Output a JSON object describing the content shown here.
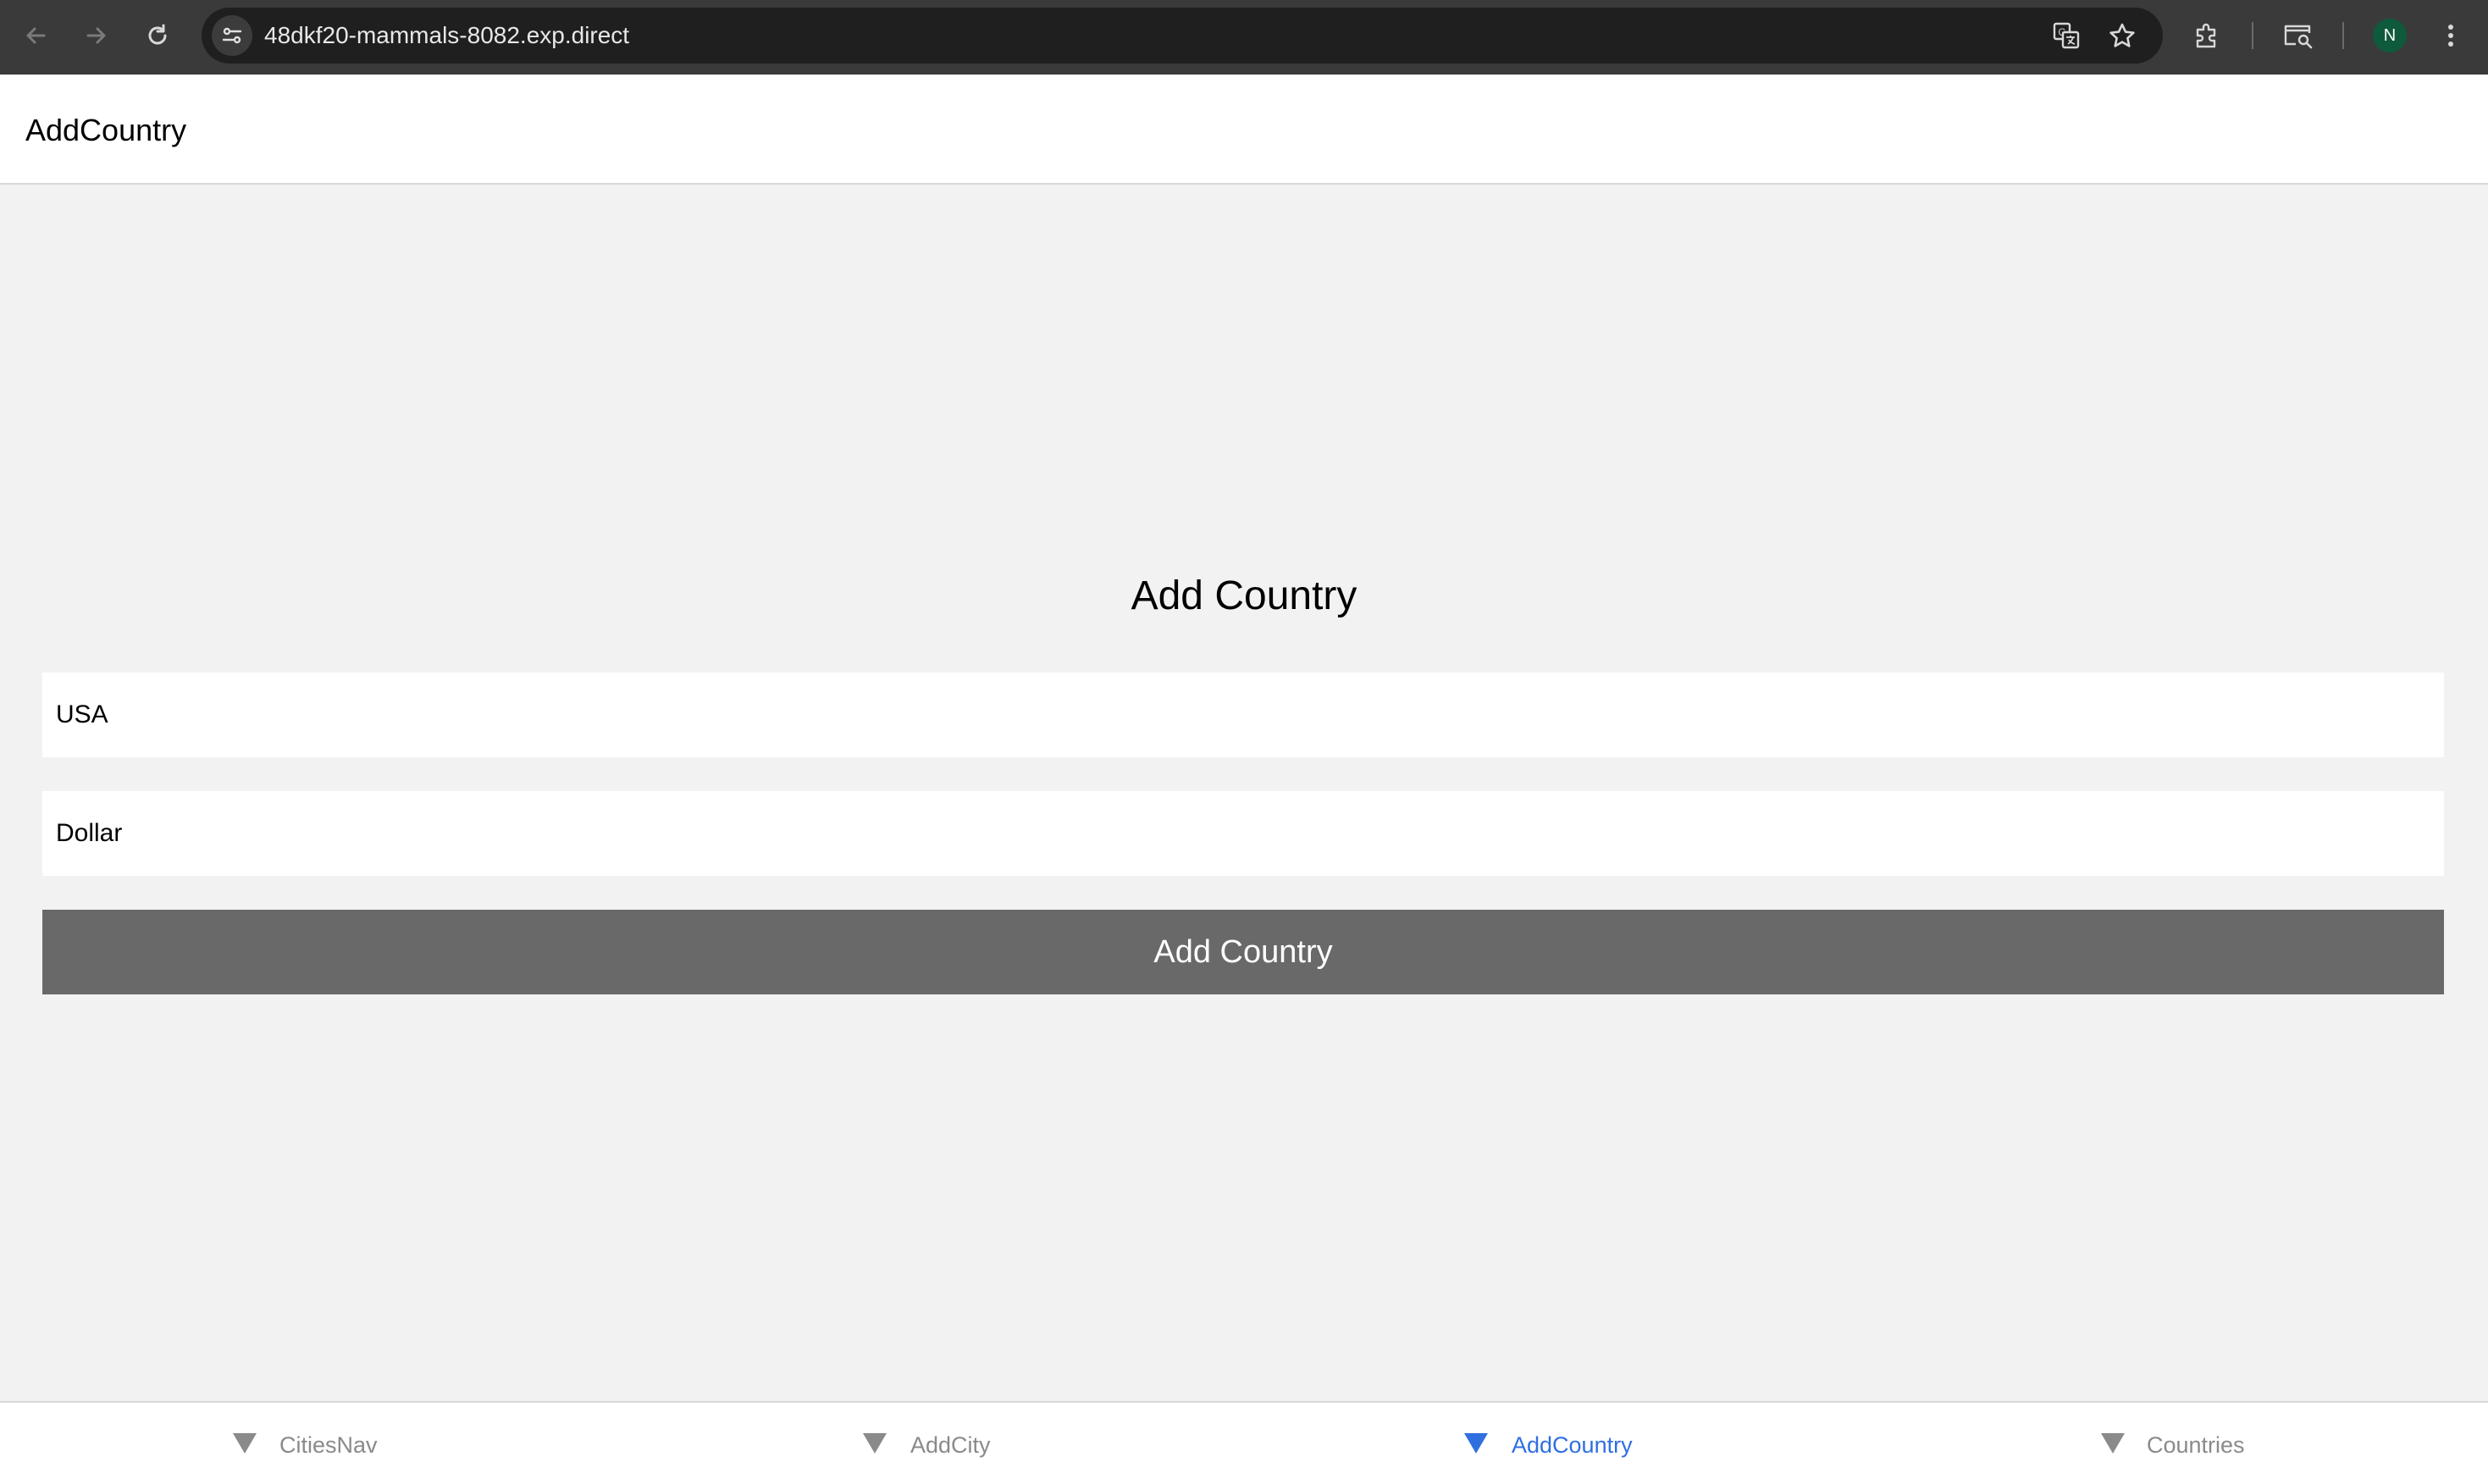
{
  "browser": {
    "url": "48dkf20-mammals-8082.exp.direct",
    "profile_initial": "N",
    "icons": [
      "back-arrow-icon",
      "forward-arrow-icon",
      "reload-icon",
      "site-settings-icon",
      "translate-icon",
      "star-icon",
      "extensions-icon",
      "tab-search-icon",
      "more-vert-icon"
    ]
  },
  "header": {
    "title": "AddCountry"
  },
  "form": {
    "heading": "Add Country",
    "country_name_value": "USA",
    "currency_value": "Dollar",
    "submit_label": "Add Country"
  },
  "tabs": [
    {
      "label": "CitiesNav",
      "icon": "triangle-down-icon",
      "active": false
    },
    {
      "label": "AddCity",
      "icon": "triangle-down-icon",
      "active": false
    },
    {
      "label": "AddCountry",
      "icon": "triangle-down-icon",
      "active": true
    },
    {
      "label": "Countries",
      "icon": "triangle-down-icon",
      "active": false
    }
  ],
  "colors": {
    "active_tab": "#2f6fe0",
    "inactive_tab": "#8a8a8a",
    "button_bg": "#696969",
    "page_bg": "#f2f2f2",
    "chrome_bg": "#3a3a3a"
  }
}
